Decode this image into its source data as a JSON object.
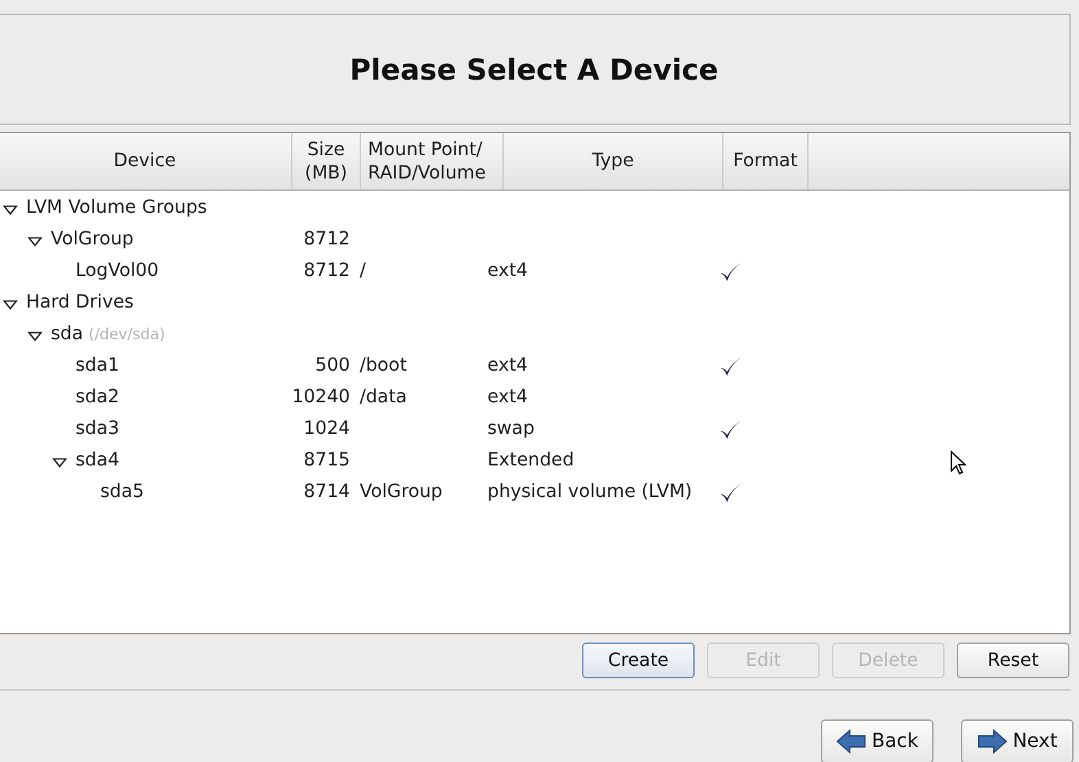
{
  "header": {
    "title": "Please Select A Device"
  },
  "table": {
    "columns": [
      "Device",
      "Size\n(MB)",
      "Mount Point/\nRAID/Volume",
      "Type",
      "Format"
    ],
    "rows": [
      {
        "device": "LVM Volume Groups",
        "expanded": true,
        "children": [
          {
            "device": "VolGroup",
            "size": "8712",
            "expanded": true,
            "children": [
              {
                "device": "LogVol00",
                "size": "8712",
                "mount": "/",
                "type": "ext4",
                "format": true
              }
            ]
          }
        ]
      },
      {
        "device": "Hard Drives",
        "expanded": true,
        "children": [
          {
            "device": "sda",
            "detail": "(/dev/sda)",
            "expanded": true,
            "children": [
              {
                "device": "sda1",
                "size": "500",
                "mount": "/boot",
                "type": "ext4",
                "format": true
              },
              {
                "device": "sda2",
                "size": "10240",
                "mount": "/data",
                "type": "ext4",
                "format": false
              },
              {
                "device": "sda3",
                "size": "1024",
                "type": "swap",
                "format": true
              },
              {
                "device": "sda4",
                "size": "8715",
                "type": "Extended",
                "expanded": true,
                "children": [
                  {
                    "device": "sda5",
                    "size": "8714",
                    "mount": "VolGroup",
                    "type": "physical volume (LVM)",
                    "format": true
                  }
                ]
              }
            ]
          }
        ]
      }
    ]
  },
  "actions": [
    {
      "label": "Create",
      "disabled": false,
      "focused": true
    },
    {
      "label": "Edit",
      "disabled": true,
      "focused": false
    },
    {
      "label": "Delete",
      "disabled": true,
      "focused": false
    },
    {
      "label": "Reset",
      "disabled": false,
      "focused": false
    }
  ],
  "navigation": [
    {
      "label": "Back",
      "kind": "back"
    },
    {
      "label": "Next",
      "kind": "next"
    }
  ]
}
